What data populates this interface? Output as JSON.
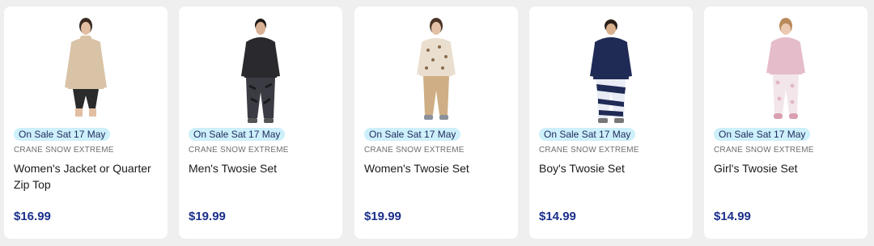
{
  "products": [
    {
      "badge": "On Sale Sat 17 May",
      "brand": "CRANE SNOW EXTREME",
      "title": "Women's Jacket or Quarter Zip Top",
      "price": "$16.99",
      "image_icon": "model-beige-top-icon",
      "colors": {
        "top": "#d9c3a6",
        "bottom": "#2b2b2b",
        "skin": "#e2bfa3",
        "hair": "#3a2b22"
      }
    },
    {
      "badge": "On Sale Sat 17 May",
      "brand": "CRANE SNOW EXTREME",
      "title": "Men's Twosie Set",
      "price": "$19.99",
      "image_icon": "model-black-twosie-icon",
      "colors": {
        "top": "#2a2a2e",
        "bottom": "#3b3b44",
        "skin": "#d9b195",
        "hair": "#1f1a17"
      }
    },
    {
      "badge": "On Sale Sat 17 May",
      "brand": "CRANE SNOW EXTREME",
      "title": "Women's Twosie Set",
      "price": "$19.99",
      "image_icon": "model-leopard-twosie-icon",
      "colors": {
        "top": "#eadfcf",
        "bottom": "#cfae85",
        "skin": "#e4c1a6",
        "hair": "#4a3426"
      }
    },
    {
      "badge": "On Sale Sat 17 May",
      "brand": "CRANE SNOW EXTREME",
      "title": "Boy's Twosie Set",
      "price": "$14.99",
      "image_icon": "model-navy-twosie-icon",
      "colors": {
        "top": "#1f2a55",
        "bottom": "#e9ecf5",
        "skin": "#d8b08e",
        "hair": "#2a1f19"
      }
    },
    {
      "badge": "On Sale Sat 17 May",
      "brand": "CRANE SNOW EXTREME",
      "title": "Girl's Twosie Set",
      "price": "$14.99",
      "image_icon": "model-pink-twosie-icon",
      "colors": {
        "top": "#e5bcc9",
        "bottom": "#f2e6ea",
        "skin": "#ecc9b2",
        "hair": "#b98a5c"
      }
    }
  ]
}
